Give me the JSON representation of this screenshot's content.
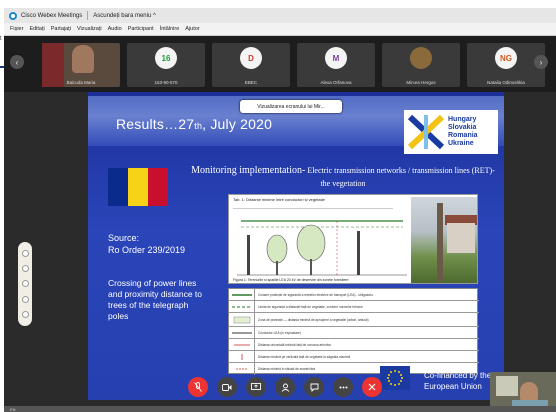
{
  "outside": {
    "label": "t"
  },
  "app": {
    "title": "Cisco Webex Meetings",
    "hide_menu": "Ascundeți bara meniu ^"
  },
  "menu": [
    "Fișier",
    "Editați",
    "Partajați",
    "Vizualizați",
    "Audio",
    "Participant",
    "Întâlnire",
    "Ajutor"
  ],
  "participants": [
    {
      "name": "Baicuda Maria",
      "initials": "",
      "video": true,
      "color": "#000000"
    },
    {
      "name": "163-90-570",
      "initials": "16",
      "video": false,
      "color": "#1e9a3a"
    },
    {
      "name": "EBEC",
      "initials": "D",
      "video": false,
      "color": "#c0392b"
    },
    {
      "name": "Alexa Orfanova",
      "initials": "M",
      "video": false,
      "color": "#7b3fa0"
    },
    {
      "name": "Mircea Hergos",
      "initials": "",
      "video": false,
      "color": "#8a6a3a"
    },
    {
      "name": "Natalia Odinoshkia",
      "initials": "NG",
      "video": false,
      "color": "#d05a20"
    }
  ],
  "viewing_chip": "Vizualizarea ecranului lui Mir...",
  "slide": {
    "title_main": "Results…27",
    "title_sup": "th",
    "title_tail": ", July 2020",
    "logo_names": [
      "Hungary",
      "Slovakia",
      "Romania",
      "Ukraine"
    ],
    "monitoring_title": "Monitoring implementation-",
    "monitoring_sub": " Electric transmission networks / transmission lines (RET)-the vegetation",
    "source_label": "Source:",
    "source_value": "Ro Order 239/2019",
    "crossing_text": "Crossing of power lines and proximity distance to trees of the telegraph poles",
    "figure_header": "Tab. 1: Distanțe minime între conductori și vegetație",
    "figure_caption": "Figura 1: Terenurile și spațiile LEA 20 kV de deservire din zonele forestiere",
    "legend_rows": [
      "Culoare protecție de siguranță a rețelelor electrice de transport (LEA) - obligatoriu",
      "Limita de siguranță a distanței față de vegetație, conform normelor tehnice",
      "Zona de protecție — distanța minimă de apropiere a vegetației (arbori, arbuști)",
      "Conductor LEA (în exploatare)",
      "Distanța orizontală minimă față de coroana arborilor",
      "Distanța minimă pe verticală față de vegetație la săgeata maximă",
      "Distanța minimă în situații de avarie/vânt"
    ],
    "cofinanced": [
      "Co-financed by the",
      "European Union"
    ],
    "flag_colors": [
      "#0a2b8c",
      "#f7d317",
      "#c8102e"
    ]
  },
  "controls": [
    "mute",
    "video",
    "share",
    "participants",
    "chat",
    "more",
    "leave"
  ],
  "bottom_label": "EN"
}
